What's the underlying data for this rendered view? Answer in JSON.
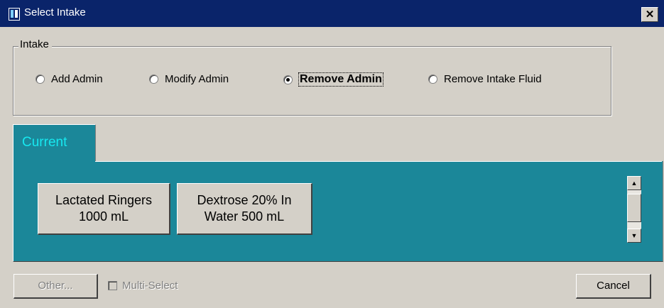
{
  "window": {
    "title": "Select Intake",
    "close_label": "✕"
  },
  "intake_group": {
    "legend": "Intake",
    "options": [
      {
        "label": "Add Admin",
        "selected": false
      },
      {
        "label": "Modify Admin",
        "selected": false
      },
      {
        "label": "Remove Admin",
        "selected": true
      },
      {
        "label": "Remove Intake Fluid",
        "selected": false
      }
    ]
  },
  "tab": {
    "label": "Current"
  },
  "fluids": [
    {
      "label": "Lactated Ringers\n1000 mL"
    },
    {
      "label": "Dextrose 20% In\nWater 500 mL"
    }
  ],
  "scrollbar": {
    "up_icon": "▲",
    "down_icon": "▼"
  },
  "footer": {
    "other_label": "Other...",
    "multiselect_label": "Multi-Select",
    "cancel_label": "Cancel"
  },
  "colors": {
    "titlebar": "#0a246a",
    "panel": "#1b8799",
    "tab_text": "#17e8f0",
    "face": "#d4d0c8"
  }
}
